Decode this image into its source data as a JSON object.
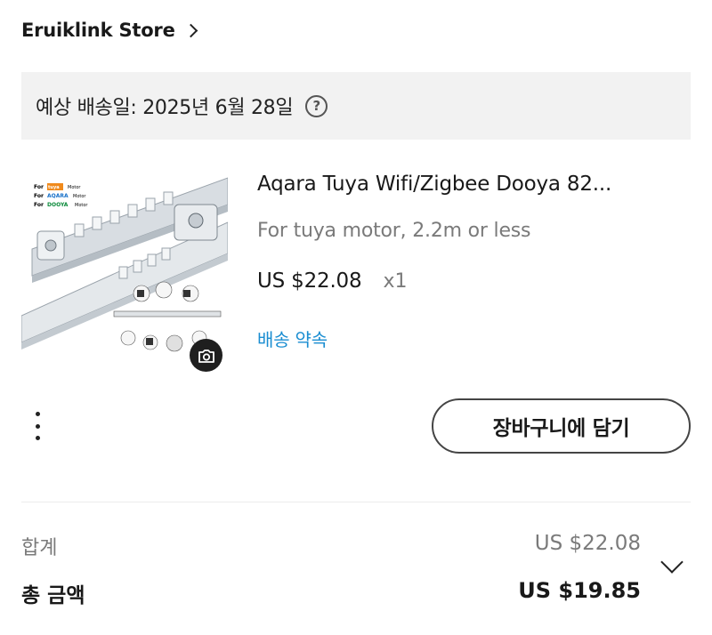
{
  "store": {
    "name": "Eruiklink Store"
  },
  "delivery": {
    "estimate": "예상 배송일: 2025년 6월 28일",
    "help_glyph": "?"
  },
  "product": {
    "title": "Aqara Tuya Wifi/Zigbee Dooya 82...",
    "variant": "For tuya motor, 2.2m or less",
    "price": "US $22.08",
    "quantity": "x1",
    "delivery_promise": "배송 약속",
    "image_labels": [
      "For",
      "tuya",
      "Motor",
      "For",
      "AQARA",
      "Motor",
      "For",
      "DOOYA",
      "Motor"
    ]
  },
  "actions": {
    "add_to_cart": "장바구니에 담기"
  },
  "summary": {
    "subtotal_label": "합계",
    "subtotal_value": "US $22.08",
    "total_label": "총 금액",
    "total_value": "US $19.85"
  },
  "colors": {
    "link": "#1a8dd1",
    "banner_bg": "#f2f2f2",
    "muted_text": "#7a7a7a"
  },
  "icons": [
    "chevron-right-icon",
    "help-circle-icon",
    "camera-icon",
    "more-vertical-icon",
    "chevron-down-icon"
  ]
}
